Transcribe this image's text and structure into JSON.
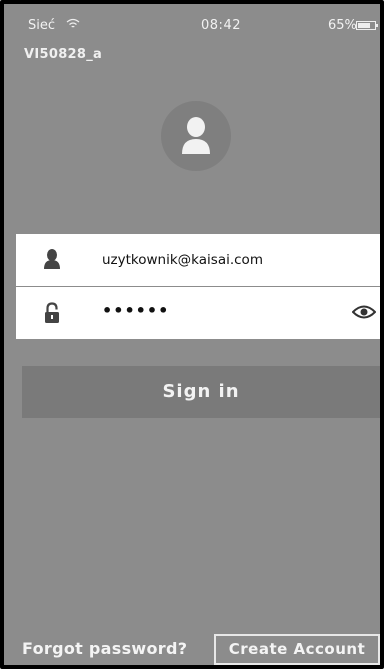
{
  "status_bar": {
    "carrier": "Sieć",
    "time": "08:42",
    "battery": "65%",
    "wifi_icon": "wifi-icon",
    "battery_icon": "battery-icon"
  },
  "device_name": "VI50828_a",
  "avatar_icon": "user-avatar-icon",
  "login": {
    "username_icon": "user-icon",
    "username_value": "uzytkownik@kaisai.com",
    "password_icon": "lock-icon",
    "password_value": "••••••",
    "show_password_icon": "eye-icon"
  },
  "actions": {
    "sign_in": "Sign in",
    "forgot_password": "Forgot password?",
    "create_account": "Create Account"
  },
  "colors": {
    "background": "#8c8c8c",
    "field_bg": "#ffffff",
    "button_bg": "#7a7a7a",
    "text_light": "#f2f2f2"
  }
}
